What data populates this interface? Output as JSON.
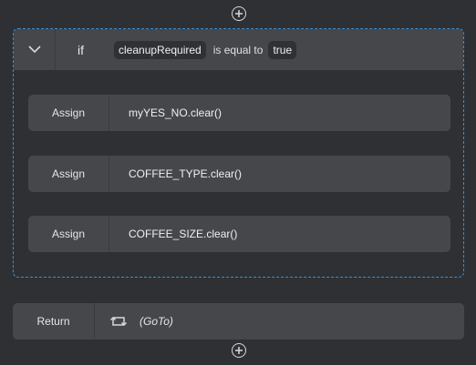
{
  "if_block": {
    "keyword": "if",
    "condition": {
      "variable": "cleanupRequired",
      "operator": "is equal to",
      "value": "true"
    },
    "statements": [
      {
        "kind": "Assign",
        "expression": "myYES_NO.clear()"
      },
      {
        "kind": "Assign",
        "expression": "COFFEE_TYPE.clear()"
      },
      {
        "kind": "Assign",
        "expression": "COFFEE_SIZE.clear()"
      }
    ]
  },
  "return_row": {
    "kind": "Return",
    "icon": "goto-loop-icon",
    "label": "(GoTo)"
  },
  "icons": {
    "add": "plus-circle-icon",
    "collapse": "chevron-down-icon"
  },
  "colors": {
    "background": "#2f3033",
    "block": "#45474b",
    "chip": "#2f3134",
    "selection_border": "#3a8fd6"
  }
}
